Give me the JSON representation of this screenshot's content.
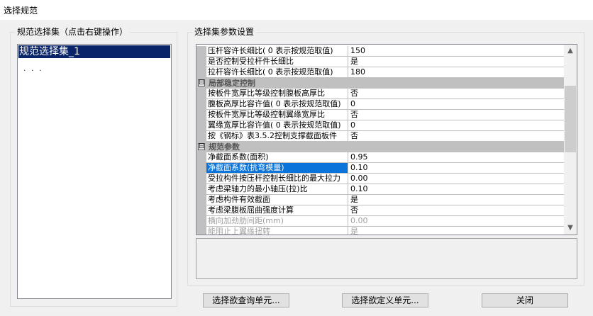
{
  "window": {
    "title": "选择规范"
  },
  "left_panel": {
    "legend": "规范选择集（点击右键操作）",
    "selected_item": "规范选择集_1",
    "child_item": "· · ·"
  },
  "right_panel": {
    "legend": "选择集参数设置",
    "rows": [
      {
        "type": "prop",
        "name": "压杆容许长细比( 0 表示按规范取值)",
        "value": "150"
      },
      {
        "type": "prop",
        "name": "是否控制受拉杆件长细比",
        "value": "是"
      },
      {
        "type": "prop",
        "name": "拉杆容许长细比( 0 表示按规范取值)",
        "value": "180"
      },
      {
        "type": "category",
        "name": "局部稳定控制",
        "toggle": "⊟"
      },
      {
        "type": "prop",
        "name": "按板件宽厚比等级控制腹板高厚比",
        "value": "否"
      },
      {
        "type": "prop",
        "name": "腹板高厚比容许值( 0 表示按规范取值)",
        "value": "0"
      },
      {
        "type": "prop",
        "name": "按板件宽厚比等级控制翼缘宽厚比",
        "value": "否"
      },
      {
        "type": "prop",
        "name": "翼缘宽厚比容许值( 0 表示按规范取值)",
        "value": "0"
      },
      {
        "type": "prop",
        "name": "按《钢标》表3.5.2控制支撑截面板件",
        "value": "否"
      },
      {
        "type": "category",
        "name": "规范参数",
        "toggle": "⊟"
      },
      {
        "type": "prop",
        "name": "净截面系数(面积)",
        "value": "0.95"
      },
      {
        "type": "prop",
        "name": "净截面系数(抗弯模量)",
        "value": "0.10",
        "selected": true
      },
      {
        "type": "prop",
        "name": "受拉构件按压杆控制长细比的最大拉力",
        "value": "0.00"
      },
      {
        "type": "prop",
        "name": "考虑梁轴力的最小轴压(拉)比",
        "value": "0.10"
      },
      {
        "type": "prop",
        "name": "考虑构件有效截面",
        "value": "是"
      },
      {
        "type": "prop",
        "name": "考虑梁腹板屈曲强度计算",
        "value": "否"
      },
      {
        "type": "prop",
        "name": "横向加劲肋间距(mm)",
        "value": "0.00",
        "disabled": true
      },
      {
        "type": "prop",
        "name": "能阻止上翼缘扭转",
        "value": "是",
        "disabled": true
      }
    ],
    "scroll_up": "▲",
    "scroll_down": "▼"
  },
  "buttons": {
    "query": "选择欲查询单元...",
    "define": "选择欲定义单元...",
    "close": "关闭"
  }
}
